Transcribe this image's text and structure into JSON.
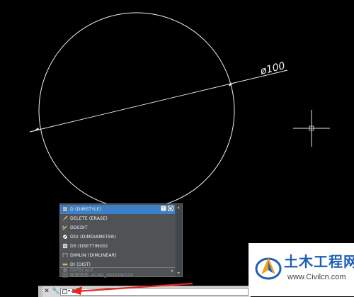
{
  "drawing": {
    "circle": {
      "diameter_label": "ø100"
    },
    "crosshair": true
  },
  "autocomplete": {
    "items": [
      {
        "label": "D (DIMSTYLE)",
        "icon": "dimstyle-icon",
        "highlighted": true
      },
      {
        "label": "DELETE (ERASE)",
        "icon": "erase-icon"
      },
      {
        "label": "DDEDIT",
        "icon": "ddedit-icon"
      },
      {
        "label": "DDI (DIMDIAMETER)",
        "icon": "dimdiameter-icon"
      },
      {
        "label": "DS (DSETTINGS)",
        "icon": "dsettings-icon"
      },
      {
        "label": "DIMLIN (DIMLINEAR)",
        "icon": "dimlinear-icon"
      },
      {
        "label": "DI (DIST)",
        "icon": "dist-icon"
      }
    ],
    "sysvar_items": [
      {
        "label": "DIMSCALE",
        "icon": "sysvar-icon"
      },
      {
        "label": "图案填充: ACAD_ISO02W100",
        "icon": "hatch-icon"
      }
    ],
    "colors": {
      "highlight": "#3b80c8",
      "background": "#4f5356"
    }
  },
  "command_line": {
    "input_value": "D",
    "prompt_symbol": "▾"
  },
  "watermark": {
    "title": "土木工程网",
    "url": "www.Civilcn.com"
  }
}
